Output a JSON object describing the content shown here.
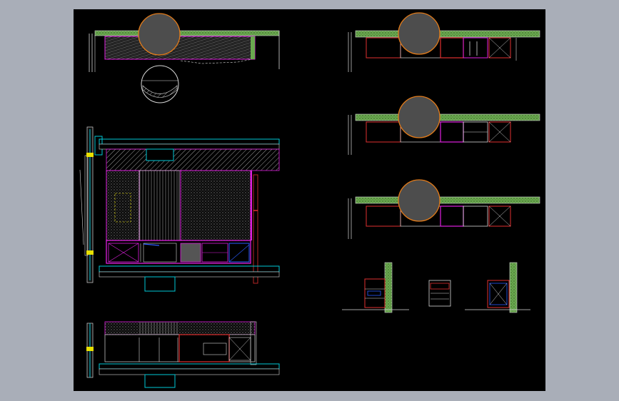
{
  "colors": {
    "app_background": "#a9aeb8",
    "canvas_background": "#000000",
    "wall_green": "#6aa84f",
    "cyan_line": "#00c8d6",
    "magenta_line": "#e020e0",
    "red_line": "#e03030",
    "white_line": "#d8d8d8",
    "callout_fill": "#4d4d4d",
    "callout_stroke": "#e07a1a",
    "blue_line": "#2a5cff",
    "yellow_mark": "#e8e000"
  },
  "drawing": {
    "views": [
      {
        "name": "plan-view-top-left",
        "kind": "plan"
      },
      {
        "name": "kitchen-elevation-main",
        "kind": "elevation"
      },
      {
        "name": "kitchen-elevation-lower",
        "kind": "elevation"
      },
      {
        "name": "plan-view-right-1",
        "kind": "plan"
      },
      {
        "name": "plan-view-right-2",
        "kind": "plan"
      },
      {
        "name": "plan-view-right-3",
        "kind": "plan"
      },
      {
        "name": "section-details-row",
        "kind": "section"
      }
    ],
    "callouts": [
      {
        "name": "callout-circle-1",
        "icon": "orange-ring-circle"
      },
      {
        "name": "callout-circle-2",
        "icon": "orange-ring-circle"
      },
      {
        "name": "callout-circle-3",
        "icon": "orange-ring-circle"
      },
      {
        "name": "callout-circle-4",
        "icon": "orange-ring-circle"
      }
    ]
  }
}
